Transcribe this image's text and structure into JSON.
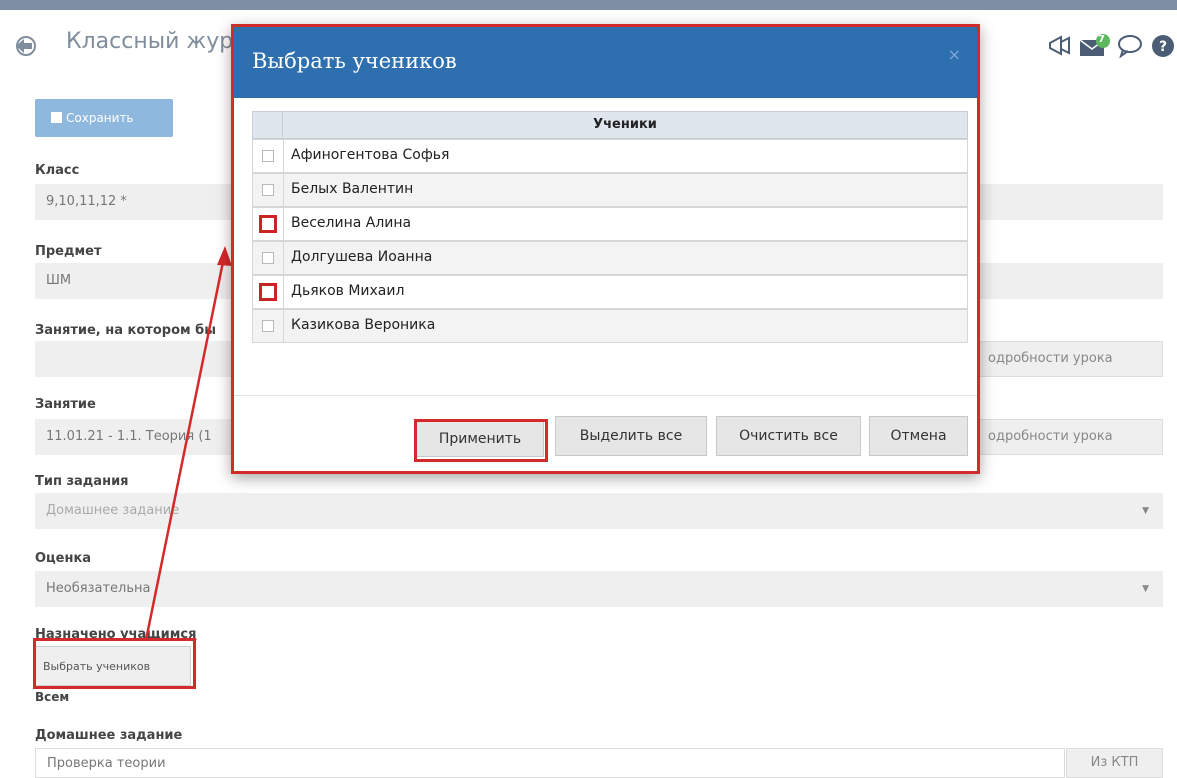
{
  "header": {
    "title": "Классный жур",
    "badge_count": "7"
  },
  "form": {
    "save_label": "Сохранить",
    "class_label": "Класс",
    "class_value": "9,10,11,12 *",
    "subject_label": "Предмет",
    "subject_value": "ШМ",
    "lesson_given_label": "Занятие, на котором бы",
    "lesson_given_value": "",
    "lesson_details_1": "одробности урока",
    "lesson_label": "Занятие",
    "lesson_value": "11.01.21 - 1.1. Теория (1",
    "lesson_details_2": "одробности урока",
    "task_type_label": "Тип задания",
    "task_type_value": "Домашнее задание",
    "grade_label": "Оценка",
    "grade_value": "Необязательна",
    "assigned_label": "Назначено учащимся",
    "choose_students_label": "Выбрать учеников",
    "all_label": "Всем",
    "homework_label": "Домашнее задание",
    "homework_value": "Проверка теории",
    "from_ktp_label": "Из КТП"
  },
  "modal": {
    "title": "Выбрать учеников",
    "close": "×",
    "column_header": "Ученики",
    "students": [
      {
        "name": "Афиногентова Софья",
        "highlighted": false
      },
      {
        "name": "Белых Валентин",
        "highlighted": false
      },
      {
        "name": "Веселина Алина",
        "highlighted": true
      },
      {
        "name": "Долгушева Иоанна",
        "highlighted": false
      },
      {
        "name": "Дьяков Михаил",
        "highlighted": true
      },
      {
        "name": "Казикова Вероника",
        "highlighted": false
      }
    ],
    "apply_label": "Применить",
    "select_all_label": "Выделить все",
    "clear_all_label": "Очистить все",
    "cancel_label": "Отмена"
  },
  "colors": {
    "modal_header": "#2e6fb0",
    "highlight": "#d42a2a",
    "save_button": "#8fb8de"
  }
}
